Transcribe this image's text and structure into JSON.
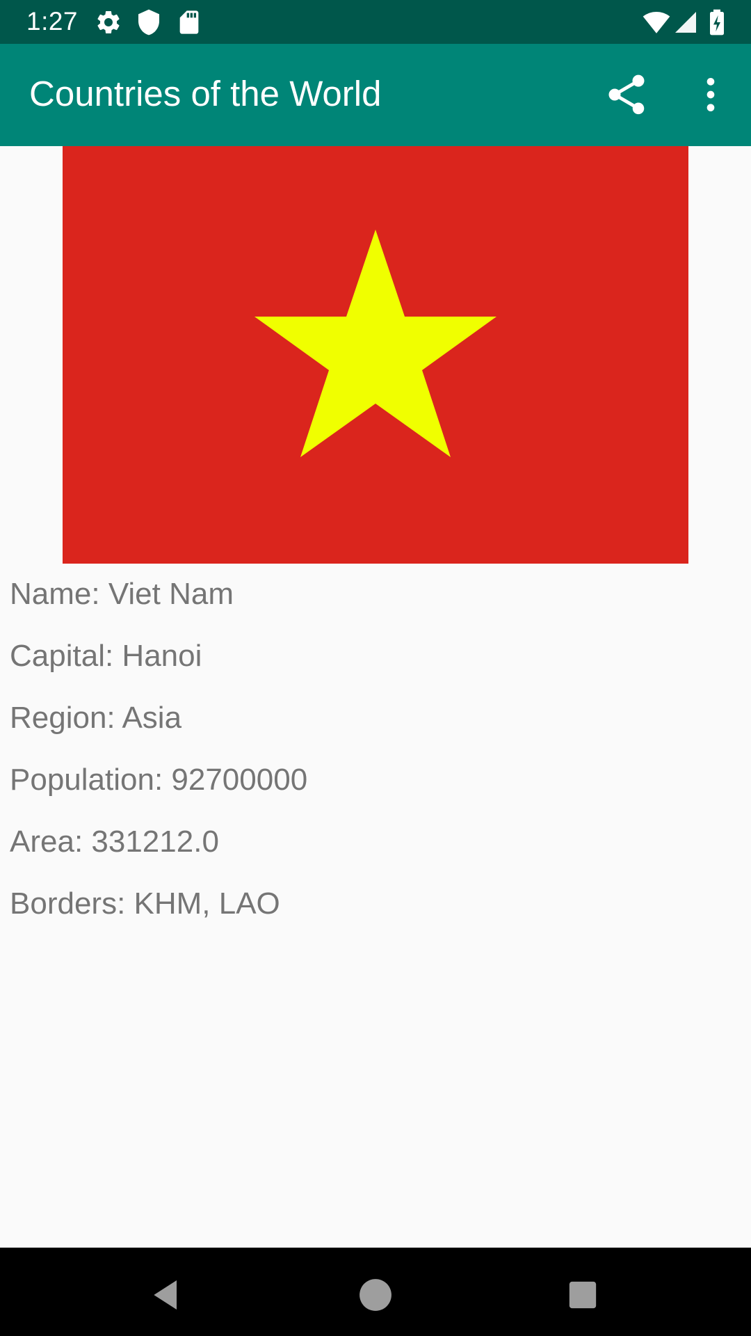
{
  "status_bar": {
    "time": "1:27",
    "icons_left": [
      "settings-icon",
      "shield-icon",
      "sd-card-icon"
    ],
    "icons_right": [
      "wifi-icon",
      "cell-signal-icon",
      "battery-charging-icon"
    ]
  },
  "app_bar": {
    "title": "Countries of the World",
    "actions": [
      "share-icon",
      "overflow-menu-icon"
    ]
  },
  "country": {
    "flag": {
      "background_color": "#DA251D",
      "star_color": "#F0FF00"
    },
    "name_line": "Name: Viet Nam",
    "capital_line": "Capital: Hanoi",
    "region_line": "Region: Asia",
    "population_line": "Population: 92700000",
    "area_line": "Area: 331212.0",
    "borders_line": "Borders: KHM, LAO"
  },
  "nav_bar": {
    "buttons": [
      "back-icon",
      "home-icon",
      "recents-icon"
    ]
  },
  "colors": {
    "status_bar": "#00574B",
    "app_bar": "#008577",
    "background": "#FAFAFA",
    "text": "#757575"
  }
}
